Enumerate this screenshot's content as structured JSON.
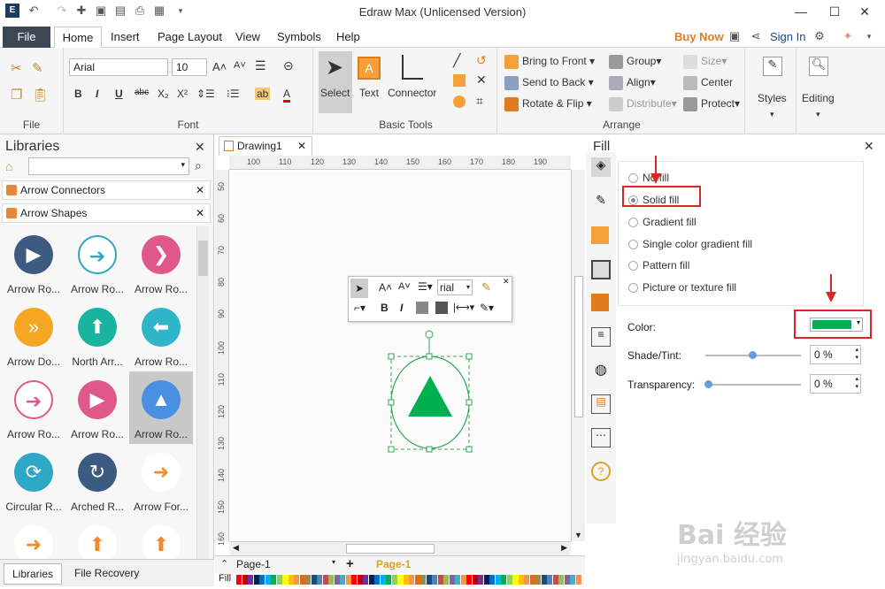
{
  "window": {
    "title": "Edraw Max (Unlicensed Version)",
    "minimize": "—",
    "maximize": "☐",
    "close": "✕"
  },
  "menu": {
    "file": "File",
    "tabs": [
      "Home",
      "Insert",
      "Page Layout",
      "View",
      "Symbols",
      "Help"
    ],
    "buy_now": "Buy Now",
    "sign_in": "Sign In"
  },
  "ribbon": {
    "file_group": "File",
    "font_group": "Font",
    "font_name": "Arial",
    "font_size": "10",
    "basic_tools_group": "Basic Tools",
    "select": "Select",
    "text": "Text",
    "connector": "Connector",
    "arrange_group": "Arrange",
    "bring_to_front": "Bring to Front",
    "send_to_back": "Send to Back",
    "rotate_flip": "Rotate & Flip",
    "group": "Group",
    "align": "Align",
    "distribute": "Distribute",
    "size": "Size",
    "center": "Center",
    "protect": "Protect",
    "styles": "Styles",
    "editing": "Editing"
  },
  "libraries": {
    "title": "Libraries",
    "sections": [
      "Arrow Connectors",
      "Arrow Shapes"
    ],
    "shapes": [
      {
        "label": "Arrow Ro...",
        "color": "#3d5a80",
        "glyph": "▶"
      },
      {
        "label": "Arrow Ro...",
        "color": "#ffffff",
        "glyph": "➔"
      },
      {
        "label": "Arrow Ro...",
        "color": "#e0588a",
        "glyph": "❯"
      },
      {
        "label": "Arrow Do...",
        "color": "#f5a623",
        "glyph": "»"
      },
      {
        "label": "North Arr...",
        "color": "#19b3a0",
        "glyph": "⬆"
      },
      {
        "label": "Arrow Ro...",
        "color": "#2fb5c8",
        "glyph": "⬅"
      },
      {
        "label": "Arrow Ro...",
        "color": "#ffffff",
        "glyph": "➔"
      },
      {
        "label": "Arrow Ro...",
        "color": "#e0588a",
        "glyph": "▶"
      },
      {
        "label": "Arrow Ro...",
        "color": "#4a90e2",
        "glyph": "▲"
      },
      {
        "label": "Circular R...",
        "color": "#2fa8c8",
        "glyph": "⟳"
      },
      {
        "label": "Arched R...",
        "color": "#3d5a80",
        "glyph": "↻"
      },
      {
        "label": "Arrow For...",
        "color": "#ffffff",
        "glyph": "➜"
      },
      {
        "label": "",
        "color": "#ffffff",
        "glyph": "➜"
      },
      {
        "label": "",
        "color": "#ffffff",
        "glyph": "⬆"
      },
      {
        "label": "",
        "color": "#ffffff",
        "glyph": "⬆"
      }
    ],
    "bottom_tabs": [
      "Libraries",
      "File Recovery"
    ]
  },
  "document": {
    "tab": "Drawing1",
    "ruler_top": [
      "100",
      "110",
      "120",
      "130",
      "140",
      "150",
      "160",
      "170",
      "180",
      "190"
    ],
    "ruler_left": [
      "50",
      "60",
      "70",
      "80",
      "90",
      "100",
      "110",
      "120",
      "130",
      "140",
      "150",
      "160"
    ],
    "float_font": "rial",
    "page_tab": "Page-1",
    "page_tab_active": "Page-1",
    "fill_label": "Fill"
  },
  "fill_panel": {
    "title": "Fill",
    "options": [
      "No fill",
      "Solid fill",
      "Gradient fill",
      "Single color gradient fill",
      "Pattern fill",
      "Picture or texture fill"
    ],
    "selected": "Solid fill",
    "color_label": "Color:",
    "color_value": "#00b050",
    "shade_label": "Shade/Tint:",
    "shade_value": "0 %",
    "transparency_label": "Transparency:",
    "transparency_value": "0 %"
  },
  "palette": [
    "#ff0000",
    "#c00000",
    "#7030a0",
    "#002060",
    "#0070c0",
    "#00b0f0",
    "#00b050",
    "#92d050",
    "#ffff00",
    "#ffc000",
    "#f79646",
    "#e36c09",
    "#948a54",
    "#1f497d",
    "#4f81bd",
    "#c0504d",
    "#9bbb59",
    "#8064a2",
    "#4bacc6",
    "#f79646"
  ],
  "watermark": {
    "line1": "Bai 经验",
    "line2": "jingyan.baidu.com"
  }
}
